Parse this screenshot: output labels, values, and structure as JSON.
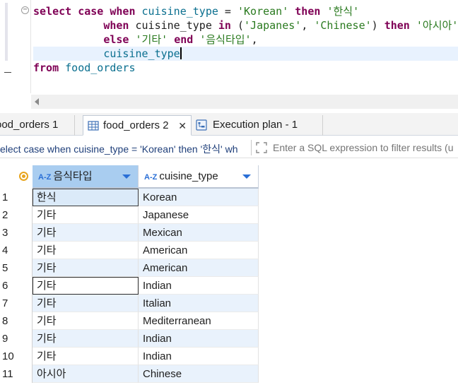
{
  "editor": {
    "lines": [
      {
        "indent": "",
        "tokens": [
          {
            "t": "select",
            "c": "kw"
          },
          {
            "t": " ",
            "c": "plain"
          },
          {
            "t": "case",
            "c": "kw"
          },
          {
            "t": " ",
            "c": "plain"
          },
          {
            "t": "when",
            "c": "kw"
          },
          {
            "t": " ",
            "c": "plain"
          },
          {
            "t": "cuisine_type",
            "c": "id"
          },
          {
            "t": " = ",
            "c": "plain"
          },
          {
            "t": "'Korean'",
            "c": "str"
          },
          {
            "t": " ",
            "c": "plain"
          },
          {
            "t": "then",
            "c": "kw"
          },
          {
            "t": " ",
            "c": "plain"
          },
          {
            "t": "'한식'",
            "c": "str"
          }
        ]
      },
      {
        "indent": "           ",
        "tokens": [
          {
            "t": "when",
            "c": "kw"
          },
          {
            "t": " cuisine_type ",
            "c": "plain"
          },
          {
            "t": "in",
            "c": "kw"
          },
          {
            "t": " (",
            "c": "plain"
          },
          {
            "t": "'Japanes'",
            "c": "str"
          },
          {
            "t": ", ",
            "c": "plain"
          },
          {
            "t": "'Chinese'",
            "c": "str"
          },
          {
            "t": ") ",
            "c": "plain"
          },
          {
            "t": "then",
            "c": "kw"
          },
          {
            "t": " ",
            "c": "plain"
          },
          {
            "t": "'아시아'",
            "c": "str"
          }
        ]
      },
      {
        "indent": "           ",
        "tokens": [
          {
            "t": "else",
            "c": "kw"
          },
          {
            "t": " ",
            "c": "plain"
          },
          {
            "t": "'기타'",
            "c": "str"
          },
          {
            "t": " ",
            "c": "plain"
          },
          {
            "t": "end",
            "c": "kw"
          },
          {
            "t": " ",
            "c": "plain"
          },
          {
            "t": "'음식타입'",
            "c": "str"
          },
          {
            "t": ",",
            "c": "plain"
          }
        ]
      },
      {
        "indent": "           ",
        "current": true,
        "caret": true,
        "tokens": [
          {
            "t": "cuisine_type",
            "c": "id"
          }
        ]
      },
      {
        "indent": "",
        "tokens": [
          {
            "t": "from",
            "c": "kw"
          },
          {
            "t": " ",
            "c": "plain"
          },
          {
            "t": "food_orders",
            "c": "id"
          }
        ]
      }
    ]
  },
  "tabs": [
    {
      "label": "ood_orders 1",
      "active": false
    },
    {
      "label": "food_orders 2",
      "active": true,
      "closable": true
    },
    {
      "label": "Execution plan - 1",
      "active": false
    }
  ],
  "filter": {
    "query_text": "elect case when cuisine_type = 'Korean' then '한식' wh",
    "placeholder": "Enter a SQL expression to filter results (u"
  },
  "grid": {
    "columns": [
      {
        "type_badge": "A-Z",
        "label": "음식타입"
      },
      {
        "type_badge": "A-Z",
        "label": "cuisine_type"
      }
    ],
    "rows": [
      {
        "n": "1",
        "c1": "한식",
        "c2": "Korean"
      },
      {
        "n": "2",
        "c1": "기타",
        "c2": "Japanese"
      },
      {
        "n": "3",
        "c1": "기타",
        "c2": "Mexican"
      },
      {
        "n": "4",
        "c1": "기타",
        "c2": "American"
      },
      {
        "n": "5",
        "c1": "기타",
        "c2": "American"
      },
      {
        "n": "6",
        "c1": "기타",
        "c2": "Indian"
      },
      {
        "n": "7",
        "c1": "기타",
        "c2": "Italian"
      },
      {
        "n": "8",
        "c1": "기타",
        "c2": "Mediterranean"
      },
      {
        "n": "9",
        "c1": "기타",
        "c2": "Indian"
      },
      {
        "n": "10",
        "c1": "기타",
        "c2": "Indian"
      },
      {
        "n": "11",
        "c1": "아시아",
        "c2": "Chinese"
      }
    ]
  },
  "colors": {
    "keyword": "#7f0055",
    "identifier": "#0a6f8f",
    "string": "#2a7a1f",
    "header_selected": "#a9cdf0",
    "row_alt": "#e9f2fc",
    "current_line": "#e8f2fe"
  },
  "icons": {
    "tab_2": "table-grid-icon",
    "tab_3": "execution-plan-icon",
    "filter": "filter-expand-icon",
    "sort": "sort-triangle-icon",
    "row_header": "row-marker-icon"
  }
}
